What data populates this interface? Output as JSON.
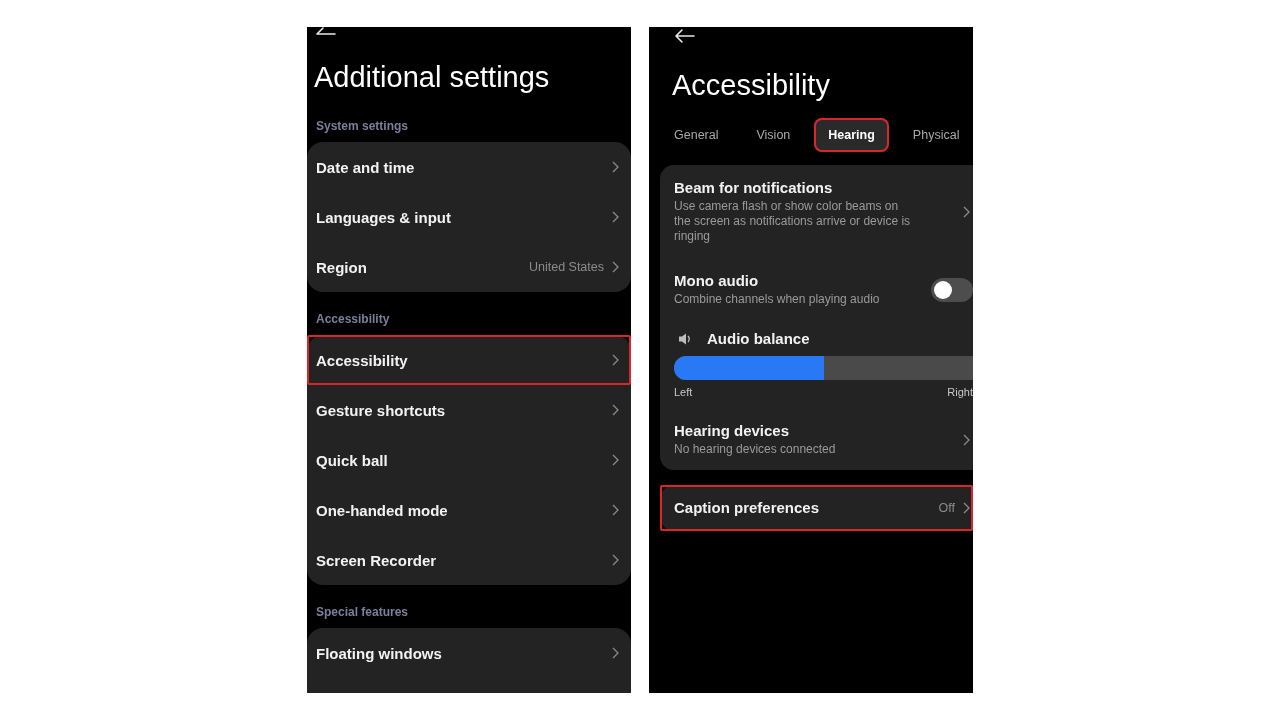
{
  "settings_screen": {
    "title": "Additional settings",
    "sections": [
      {
        "heading": "System settings",
        "items": [
          {
            "label": "Date and time",
            "highlighted": false
          },
          {
            "label": "Languages & input",
            "highlighted": false
          },
          {
            "label": "Region",
            "value": "United States",
            "highlighted": false
          }
        ]
      },
      {
        "heading": "Accessibility",
        "items": [
          {
            "label": "Accessibility",
            "highlighted": true
          },
          {
            "label": "Gesture shortcuts",
            "highlighted": false
          },
          {
            "label": "Quick ball",
            "highlighted": false
          },
          {
            "label": "One-handed mode",
            "highlighted": false
          },
          {
            "label": "Screen Recorder",
            "highlighted": false
          }
        ]
      },
      {
        "heading": "Special features",
        "items": [
          {
            "label": "Floating windows",
            "highlighted": false
          }
        ]
      }
    ]
  },
  "accessibility_screen": {
    "title": "Accessibility",
    "tabs": [
      {
        "label": "General",
        "selected": false,
        "highlighted": false
      },
      {
        "label": "Vision",
        "selected": false,
        "highlighted": false
      },
      {
        "label": "Hearing",
        "selected": true,
        "highlighted": true
      },
      {
        "label": "Physical",
        "selected": false,
        "highlighted": false
      }
    ],
    "groups": [
      {
        "items": [
          {
            "kind": "link",
            "title": "Beam for notifications",
            "description": "Use camera flash or show color beams on the screen as notifications arrive or device is ringing",
            "highlighted": false
          },
          {
            "kind": "toggle",
            "title": "Mono audio",
            "description": "Combine channels when playing audio",
            "on": false,
            "highlighted": false
          },
          {
            "kind": "slider",
            "title": "Audio balance",
            "level": 0.5,
            "min_label": "Left",
            "max_label": "Right",
            "highlighted": false
          },
          {
            "kind": "link",
            "title": "Hearing devices",
            "description": "No hearing devices connected",
            "highlighted": false
          }
        ]
      },
      {
        "items": [
          {
            "kind": "link",
            "title": "Caption preferences",
            "value": "Off",
            "highlighted": true
          }
        ]
      }
    ]
  }
}
